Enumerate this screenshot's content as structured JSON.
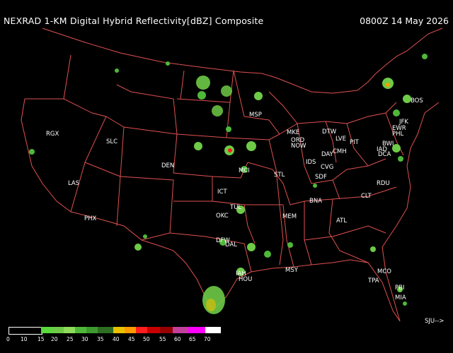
{
  "header": {
    "product_title": "NEXRAD 1-KM Digital Hybrid Reflectivity[dBZ] Composite",
    "timestamp": "0800Z 14 May 2026"
  },
  "map": {
    "stations": [
      "RGX",
      "SLC",
      "DEN",
      "LAS",
      "PHX",
      "MSP",
      "MKE",
      "ORD",
      "NOW",
      "DTW",
      "LVE",
      "CMH",
      "DAY",
      "PIT",
      "IDS",
      "CVG",
      "SDF",
      "MCI",
      "STL",
      "ICT",
      "TUL",
      "OKC",
      "DFW",
      "DAL",
      "MEM",
      "BNA",
      "ATL",
      "CLT",
      "RDU",
      "MSY",
      "IAH",
      "HOU",
      "MCO",
      "TPA",
      "PBI",
      "MIA",
      "BOS",
      "JFK",
      "EWR",
      "PHL",
      "BWI",
      "IAD",
      "DCA"
    ],
    "offmap_label": "SJU-->",
    "colors": {
      "background": "#000000",
      "borders": "#e05050",
      "echo_light": "#6ecb47",
      "echo_dark": "#2f7a24"
    }
  },
  "legend": {
    "ticks": [
      "0",
      "10",
      "15",
      "20",
      "25",
      "30",
      "35",
      "40",
      "45",
      "50",
      "55",
      "60",
      "65",
      "70"
    ],
    "colors": [
      "#000000",
      "#000000",
      "#5ad83c",
      "#6ecb47",
      "#4fb83a",
      "#3d9a2e",
      "#2d6e22",
      "#eac100",
      "#ff9a00",
      "#ff1e1e",
      "#c80000",
      "#960000",
      "#ff00ff",
      "#ffffff"
    ]
  }
}
